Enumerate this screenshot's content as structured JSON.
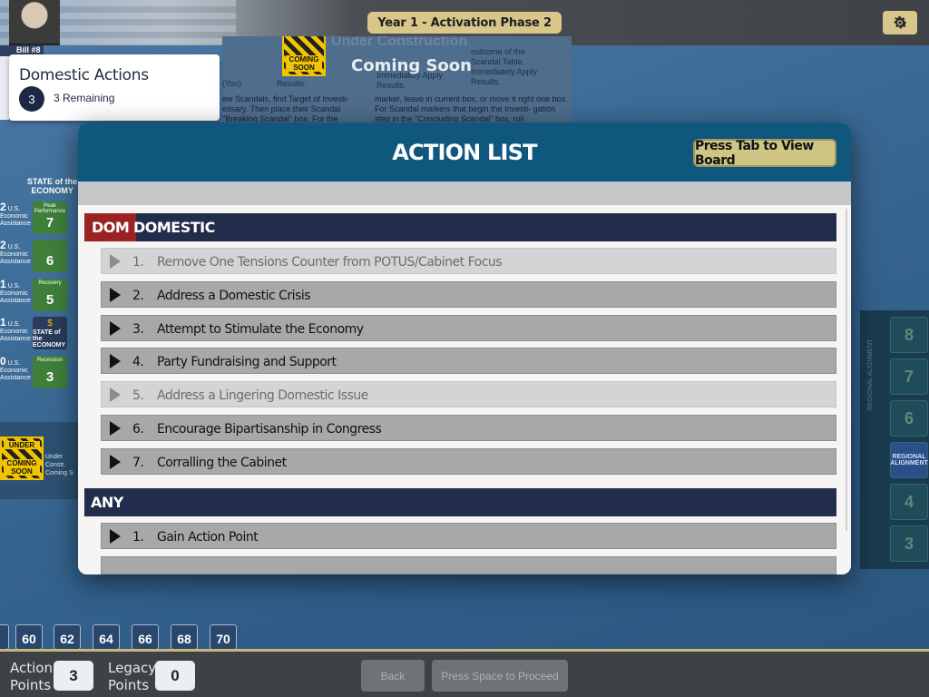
{
  "topbar": {
    "phase": "Year 1  -  Activation Phase 2",
    "bill_tab": "Bill #8"
  },
  "domestic_card": {
    "title": "Domestic Actions",
    "count": "3",
    "remaining": "3 Remaining"
  },
  "board": {
    "under_construction": "Under Construction",
    "coming_soon": "Coming Soon",
    "warn_top": "UNDER",
    "warn_bottom": "COMING SOON",
    "left_uc_text": "Under Constr. Coming S",
    "text_col1": "ew Scandals, find Target of Investi- essary. Then place their Scandal \"Breaking Scandal\" box. For the",
    "text_col2": "marker, leave in current box, or move it right one box. For Scandal markers that begin the Investi- gation step in the \"Concluding Scandal\" box, roll",
    "text_col3": "outcome of the Scandal Table. Immediately Apply Results.",
    "text_col4": "Immediately Apply Results.",
    "text_col0": "(You)",
    "text_result": "Results.",
    "economy": {
      "header_small": "STATE of the",
      "header": "ECONOMY",
      "rows": [
        {
          "label_num": "2",
          "label": "U.S. Economic Assistance",
          "box_top": "Peak Performance",
          "value": "7"
        },
        {
          "label_num": "2",
          "label": "U.S. Economic Assistance",
          "box_top": "",
          "value": "6"
        },
        {
          "label_num": "1",
          "label": "U.S. Economic Assistance",
          "box_top": "Recovery",
          "value": "5"
        },
        {
          "label_num": "1",
          "label": "U.S. Economic Assistance",
          "box_top": "$",
          "value": "STATE of the ECONOMY"
        },
        {
          "label_num": "0",
          "label": "U.S. Economic Assistance",
          "box_top": "Recession",
          "value": "3"
        }
      ]
    },
    "regional": {
      "label": "REGIONAL ALIGNMENT",
      "cells": [
        "8",
        "7",
        "6",
        "REGIONAL ALIGNMENT",
        "4",
        "3"
      ]
    },
    "track": [
      "60",
      "62",
      "64",
      "66",
      "68",
      "70"
    ]
  },
  "dialog": {
    "title": "ACTION LIST",
    "tab_button": "Press Tab to View Board",
    "sections": [
      {
        "tag": "DOM",
        "name": "DOMESTIC",
        "actions": [
          {
            "num": "1.",
            "label": "Remove One Tensions Counter from POTUS/Cabinet Focus",
            "enabled": false
          },
          {
            "num": "2.",
            "label": "Address a Domestic Crisis",
            "enabled": true
          },
          {
            "num": "3.",
            "label": "Attempt to Stimulate the Economy",
            "enabled": true
          },
          {
            "num": "4.",
            "label": "Party Fundraising and Support",
            "enabled": true
          },
          {
            "num": "5.",
            "label": "Address a Lingering Domestic Issue",
            "enabled": false
          },
          {
            "num": "6.",
            "label": "Encourage Bipartisanship in Congress",
            "enabled": true
          },
          {
            "num": "7.",
            "label": "Corralling the Cabinet",
            "enabled": true
          }
        ]
      },
      {
        "tag": "",
        "name": "ANY",
        "actions": [
          {
            "num": "1.",
            "label": "Gain Action Point",
            "enabled": true
          }
        ]
      }
    ]
  },
  "bottombar": {
    "action_points_label_1": "Action",
    "action_points_label_2": "Points",
    "action_points_value": "3",
    "legacy_points_label_1": "Legacy",
    "legacy_points_label_2": "Points",
    "legacy_points_value": "0",
    "back_button": "Back",
    "proceed_button": "Press Space to Proceed"
  },
  "icons": {
    "settings": "gear-icon",
    "chevron": "chevron-right-icon"
  },
  "colors": {
    "dialog_header": "#10577e",
    "section_header": "#222c4b",
    "dom_tag": "#9b2222",
    "gold_button": "#cfc585"
  }
}
